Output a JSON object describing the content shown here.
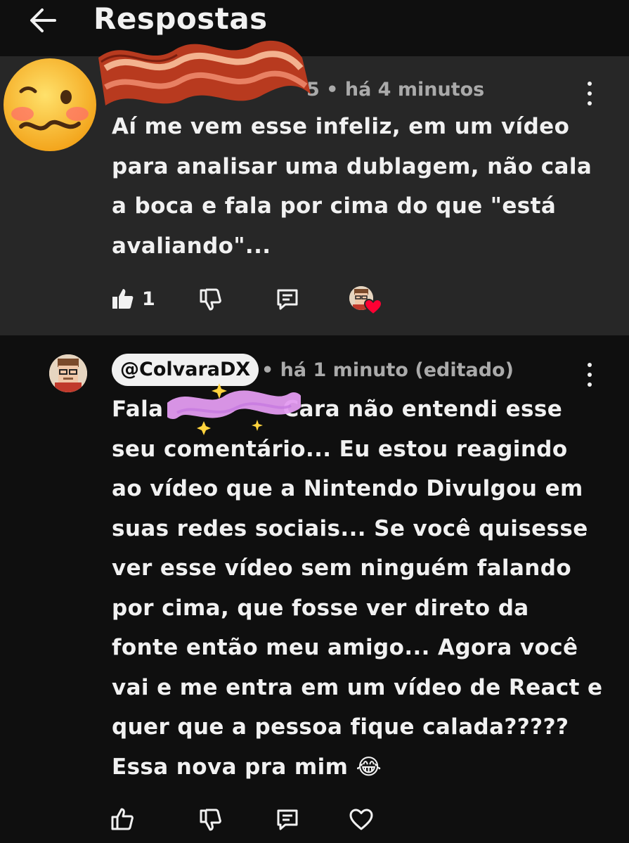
{
  "header": {
    "title": "Respostas"
  },
  "parent_comment": {
    "meta_visible": "5 • há 4 minutos",
    "body_lines": [
      "Aí me vem esse infeliz, em um vídeo",
      "para analisar uma dublagem, não cala",
      "a boca e fala por cima do que \"está",
      "avaliando\"..."
    ],
    "like_count": "1",
    "creator_heart": true
  },
  "reply_comment": {
    "author": "@ColvaraDX",
    "meta": "• há 1 minuto (editado)",
    "line1_start": "Fala",
    "line1_end": "Cara não entendi esse",
    "body_lines": [
      "seu comentário... Eu estou reagindo",
      "ao vídeo que a Nintendo Divulgou em",
      "suas redes sociais... Se você quisesse",
      "ver esse vídeo sem ninguém falando",
      "por cima, que fosse ver direto da",
      "fonte então meu amigo... Agora você",
      "vai e me entra em um vídeo de React e",
      "quer que a pessoa fique calada?????",
      "Essa nova pra mim 😂"
    ]
  },
  "colors": {
    "background": "#0f0f0f",
    "parent_background": "#272727",
    "text": "#f1f1f1",
    "muted": "#aaaaaa",
    "heart": "#ff0033"
  },
  "icons": [
    "back-arrow-icon",
    "kebab-menu-icon",
    "like-icon",
    "dislike-icon",
    "reply-icon",
    "heart-icon",
    "laughing-emoji",
    "woozy-face-sticker",
    "bacon-sticker",
    "sparkle-scribble-sticker"
  ]
}
